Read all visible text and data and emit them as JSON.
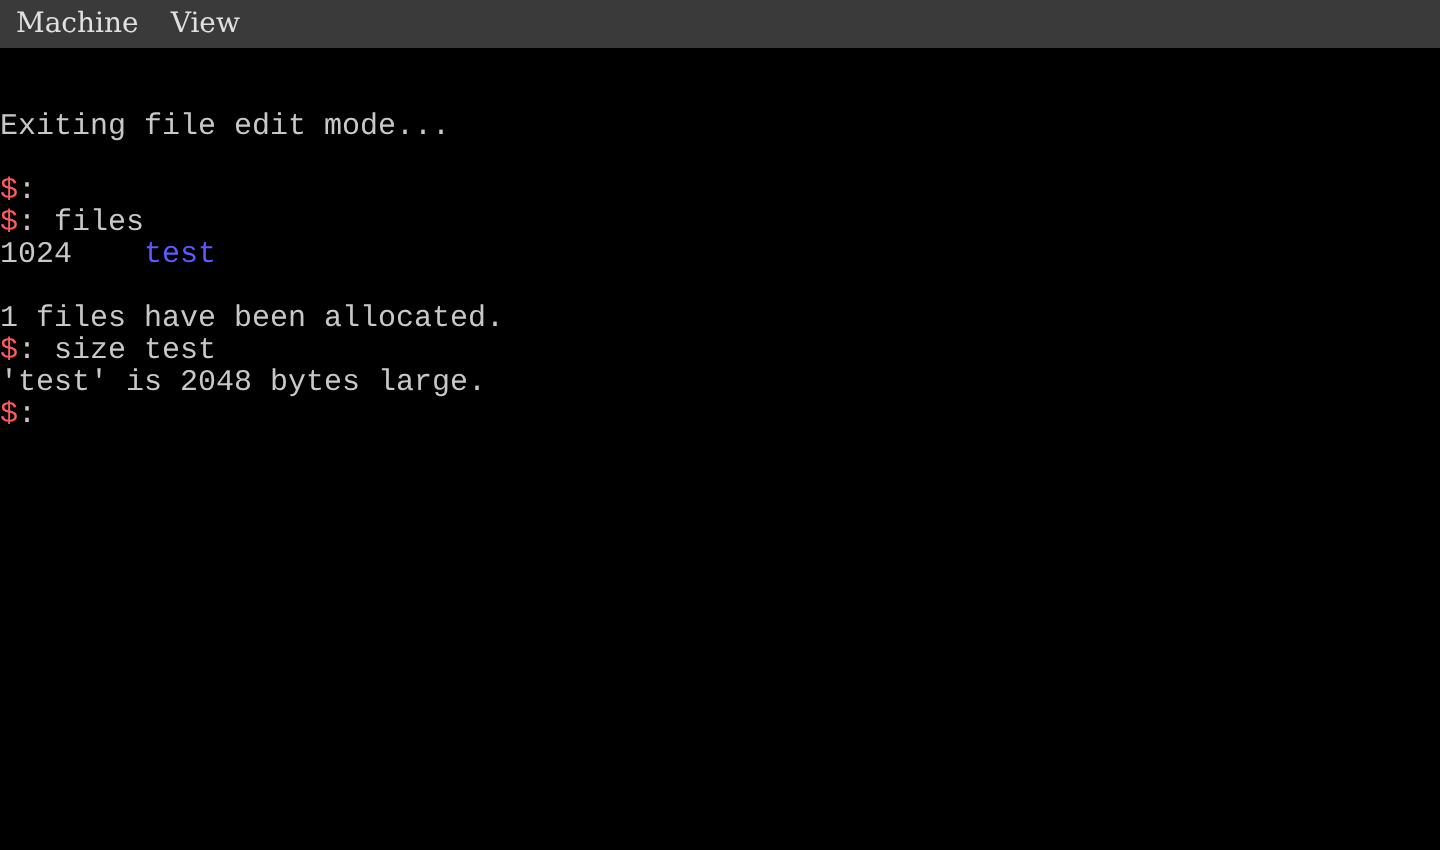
{
  "menu_bar": {
    "items": [
      "Machine",
      "View"
    ]
  },
  "terminal": {
    "lines": [
      {
        "kind": "blank"
      },
      {
        "kind": "text",
        "text": "Exiting file edit mode..."
      },
      {
        "kind": "blank"
      },
      {
        "kind": "prompt",
        "symbol": "$",
        "separator": ":"
      },
      {
        "kind": "prompt",
        "symbol": "$",
        "separator": ":",
        "command": "files"
      },
      {
        "kind": "file",
        "size": "1024",
        "name": "test"
      },
      {
        "kind": "blank"
      },
      {
        "kind": "text",
        "text": "1 files have been allocated."
      },
      {
        "kind": "prompt",
        "symbol": "$",
        "separator": ":",
        "command": "size test"
      },
      {
        "kind": "text",
        "text": "'test' is 2048 bytes large."
      },
      {
        "kind": "prompt",
        "symbol": "$",
        "separator": ":"
      }
    ]
  }
}
